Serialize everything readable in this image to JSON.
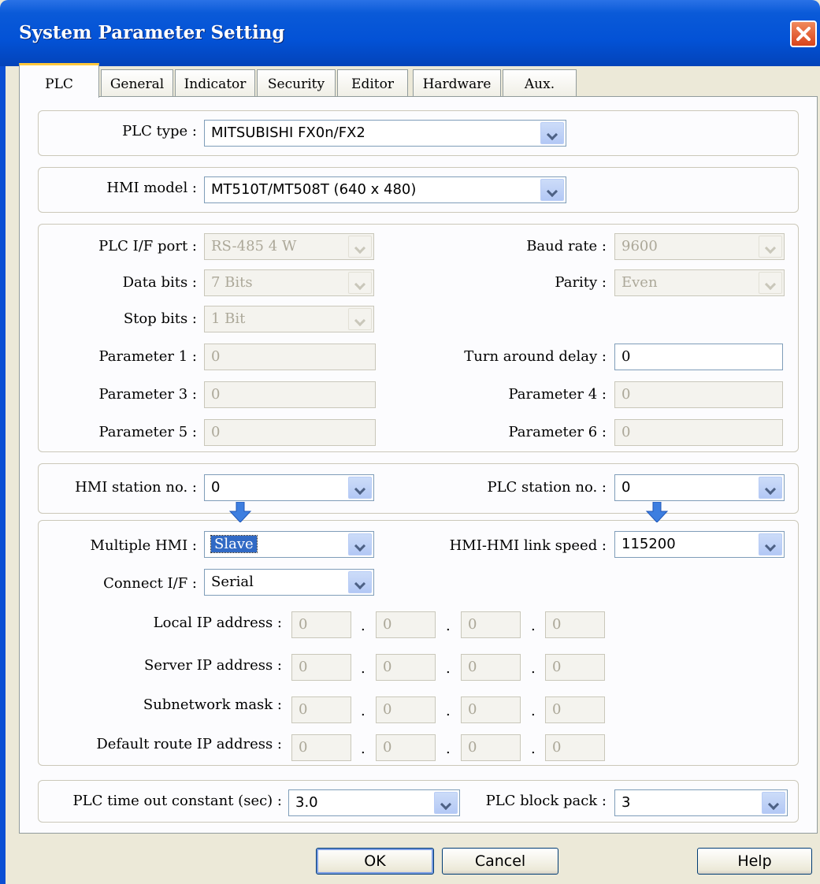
{
  "window": {
    "title": "System Parameter Setting"
  },
  "icons": {
    "close": "close-x-icon",
    "dropdown": "chevron-down-icon",
    "pointer": "blue-down-arrow-icon"
  },
  "colors": {
    "titlebar": "#0352d6",
    "close_button": "#d9431b",
    "selection": "#316ac5",
    "active_tab_accent": "#ffc83c"
  },
  "tabs": [
    {
      "label": "PLC",
      "active": true
    },
    {
      "label": "General"
    },
    {
      "label": "Indicator"
    },
    {
      "label": "Security"
    },
    {
      "label": "Editor"
    },
    {
      "label": "Hardware"
    },
    {
      "label": "Aux."
    }
  ],
  "plc_type": {
    "label": "PLC type :",
    "value": "MITSUBISHI FX0n/FX2"
  },
  "hmi_model": {
    "label": "HMI model :",
    "value": "MT510T/MT508T (640 x 480)"
  },
  "comm": {
    "plc_if_port": {
      "label": "PLC I/F port :",
      "value": "RS-485 4 W"
    },
    "baud_rate": {
      "label": "Baud rate :",
      "value": "9600"
    },
    "data_bits": {
      "label": "Data bits :",
      "value": "7 Bits"
    },
    "parity": {
      "label": "Parity :",
      "value": "Even"
    },
    "stop_bits": {
      "label": "Stop bits :",
      "value": "1 Bit"
    },
    "param1": {
      "label": "Parameter 1 :",
      "value": "0"
    },
    "turn_around": {
      "label": "Turn around delay :",
      "value": "0"
    },
    "param3": {
      "label": "Parameter 3 :",
      "value": "0"
    },
    "param4": {
      "label": "Parameter 4 :",
      "value": "0"
    },
    "param5": {
      "label": "Parameter 5 :",
      "value": "0"
    },
    "param6": {
      "label": "Parameter 6 :",
      "value": "0"
    }
  },
  "station": {
    "hmi": {
      "label": "HMI station no. :",
      "value": "0"
    },
    "plc": {
      "label": "PLC station no. :",
      "value": "0"
    }
  },
  "multi": {
    "multiple_hmi": {
      "label": "Multiple HMI :",
      "value": "Slave"
    },
    "link_speed": {
      "label": "HMI-HMI link speed :",
      "value": "115200"
    },
    "connect_if": {
      "label": "Connect I/F :",
      "value": "Serial"
    },
    "local_ip": {
      "label": "Local IP address :",
      "octets": [
        "0",
        "0",
        "0",
        "0"
      ]
    },
    "server_ip": {
      "label": "Server IP address :",
      "octets": [
        "0",
        "0",
        "0",
        "0"
      ]
    },
    "subnet": {
      "label": "Subnetwork mask :",
      "octets": [
        "0",
        "0",
        "0",
        "0"
      ]
    },
    "route_ip": {
      "label": "Default route IP address :",
      "octets": [
        "0",
        "0",
        "0",
        "0"
      ]
    },
    "dot": "."
  },
  "timeout": {
    "constant": {
      "label": "PLC time out constant (sec) :",
      "value": "3.0"
    },
    "block_pack": {
      "label": "PLC block pack :",
      "value": "3"
    }
  },
  "buttons": {
    "ok": "OK",
    "cancel": "Cancel",
    "help": "Help"
  }
}
